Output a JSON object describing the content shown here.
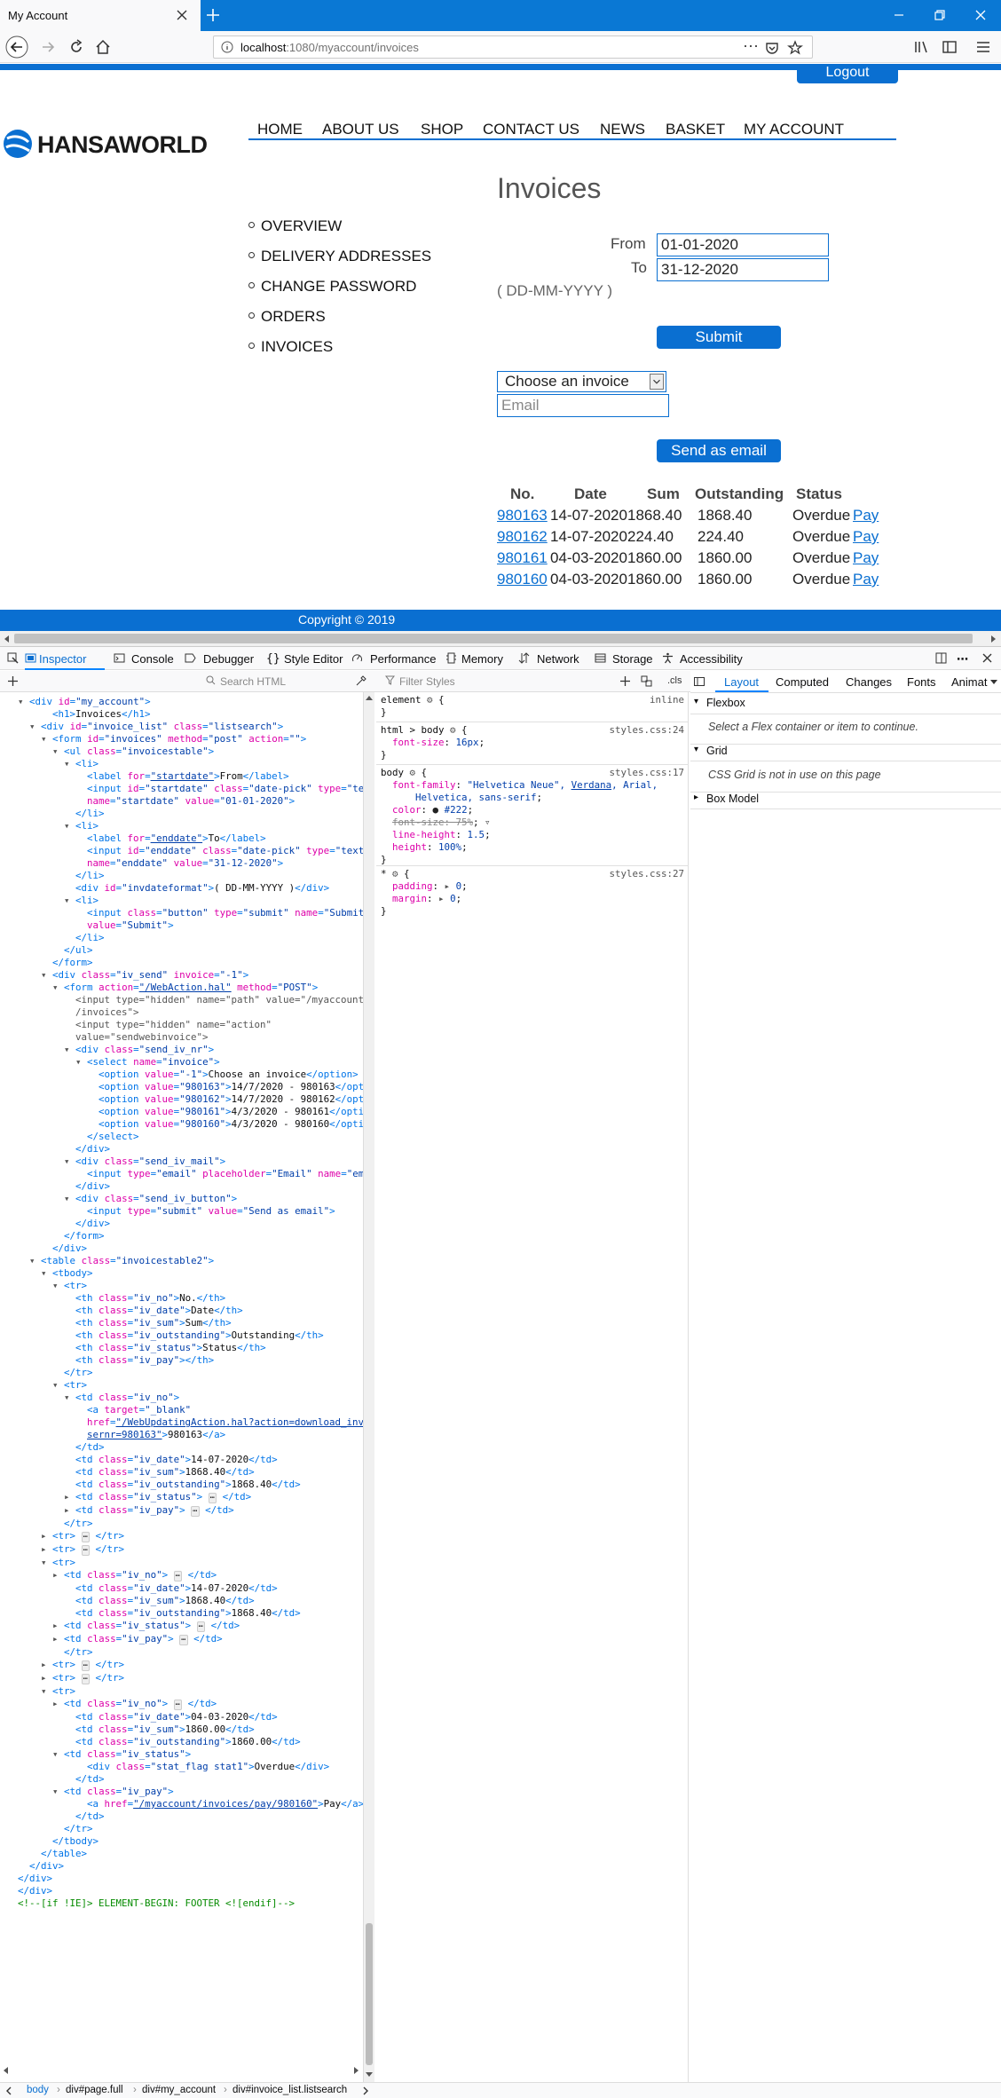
{
  "browser": {
    "tab_title": "My Account",
    "url_host": "localhost",
    "url_path": ":1080/myaccount/invoices",
    "url_dots": "···"
  },
  "header": {
    "logout_label": "Logout",
    "logo_text": "HANSAWORLD",
    "nav": [
      "HOME",
      "ABOUT US",
      "SHOP",
      "CONTACT US",
      "NEWS",
      "BASKET",
      "MY ACCOUNT"
    ]
  },
  "sidebar": {
    "items": [
      "OVERVIEW",
      "DELIVERY ADDRESSES",
      "CHANGE PASSWORD",
      "ORDERS",
      "INVOICES"
    ]
  },
  "invoices": {
    "title": "Invoices",
    "from_label": "From",
    "from_value": "01-01-2020",
    "to_label": "To",
    "to_value": "31-12-2020",
    "date_format": "( DD-MM-YYYY )",
    "submit_label": "Submit",
    "select_value": "Choose an invoice",
    "email_placeholder": "Email",
    "send_label": "Send as email",
    "columns": [
      "No.",
      "Date",
      "Sum",
      "Outstanding",
      "Status"
    ],
    "rows": [
      {
        "no": "980163",
        "date": "14-07-2020",
        "sum": "1868.40",
        "outstanding": "1868.40",
        "status": "Overdue",
        "pay": "Pay"
      },
      {
        "no": "980162",
        "date": "14-07-2020",
        "sum": "224.40",
        "outstanding": "224.40",
        "status": "Overdue",
        "pay": "Pay"
      },
      {
        "no": "980161",
        "date": "04-03-2020",
        "sum": "1860.00",
        "outstanding": "1860.00",
        "status": "Overdue",
        "pay": "Pay"
      },
      {
        "no": "980160",
        "date": "04-03-2020",
        "sum": "1860.00",
        "outstanding": "1860.00",
        "status": "Overdue",
        "pay": "Pay"
      }
    ]
  },
  "footer": {
    "copyright": "Copyright © 2019"
  },
  "devtools": {
    "tabs": [
      "Inspector",
      "Console",
      "Debugger",
      "Style Editor",
      "Performance",
      "Memory",
      "Network",
      "Storage",
      "Accessibility"
    ],
    "search_html_placeholder": "Search HTML",
    "filter_styles_placeholder": "Filter Styles",
    "cls_label": ".cls",
    "layout_tabs": [
      "Layout",
      "Computed",
      "Changes",
      "Fonts",
      "Animat"
    ],
    "layout_sections": {
      "flexbox": "Flexbox",
      "flexbox_msg": "Select a Flex container or item to continue.",
      "grid": "Grid",
      "grid_msg": "CSS Grid is not in use on this page",
      "boxmodel": "Box Model"
    },
    "breadcrumbs": [
      "body",
      "div#page.full",
      "div#my_account",
      "div#invoice_list.listsearch"
    ],
    "css_rules": {
      "element_sel": "element",
      "element_src": "inline",
      "html_sel": "html > body",
      "html_src": "styles.css:24",
      "body_sel": "body",
      "body_src": "styles.css:17",
      "star_sel": "*",
      "star_src": "styles.css:27"
    }
  }
}
